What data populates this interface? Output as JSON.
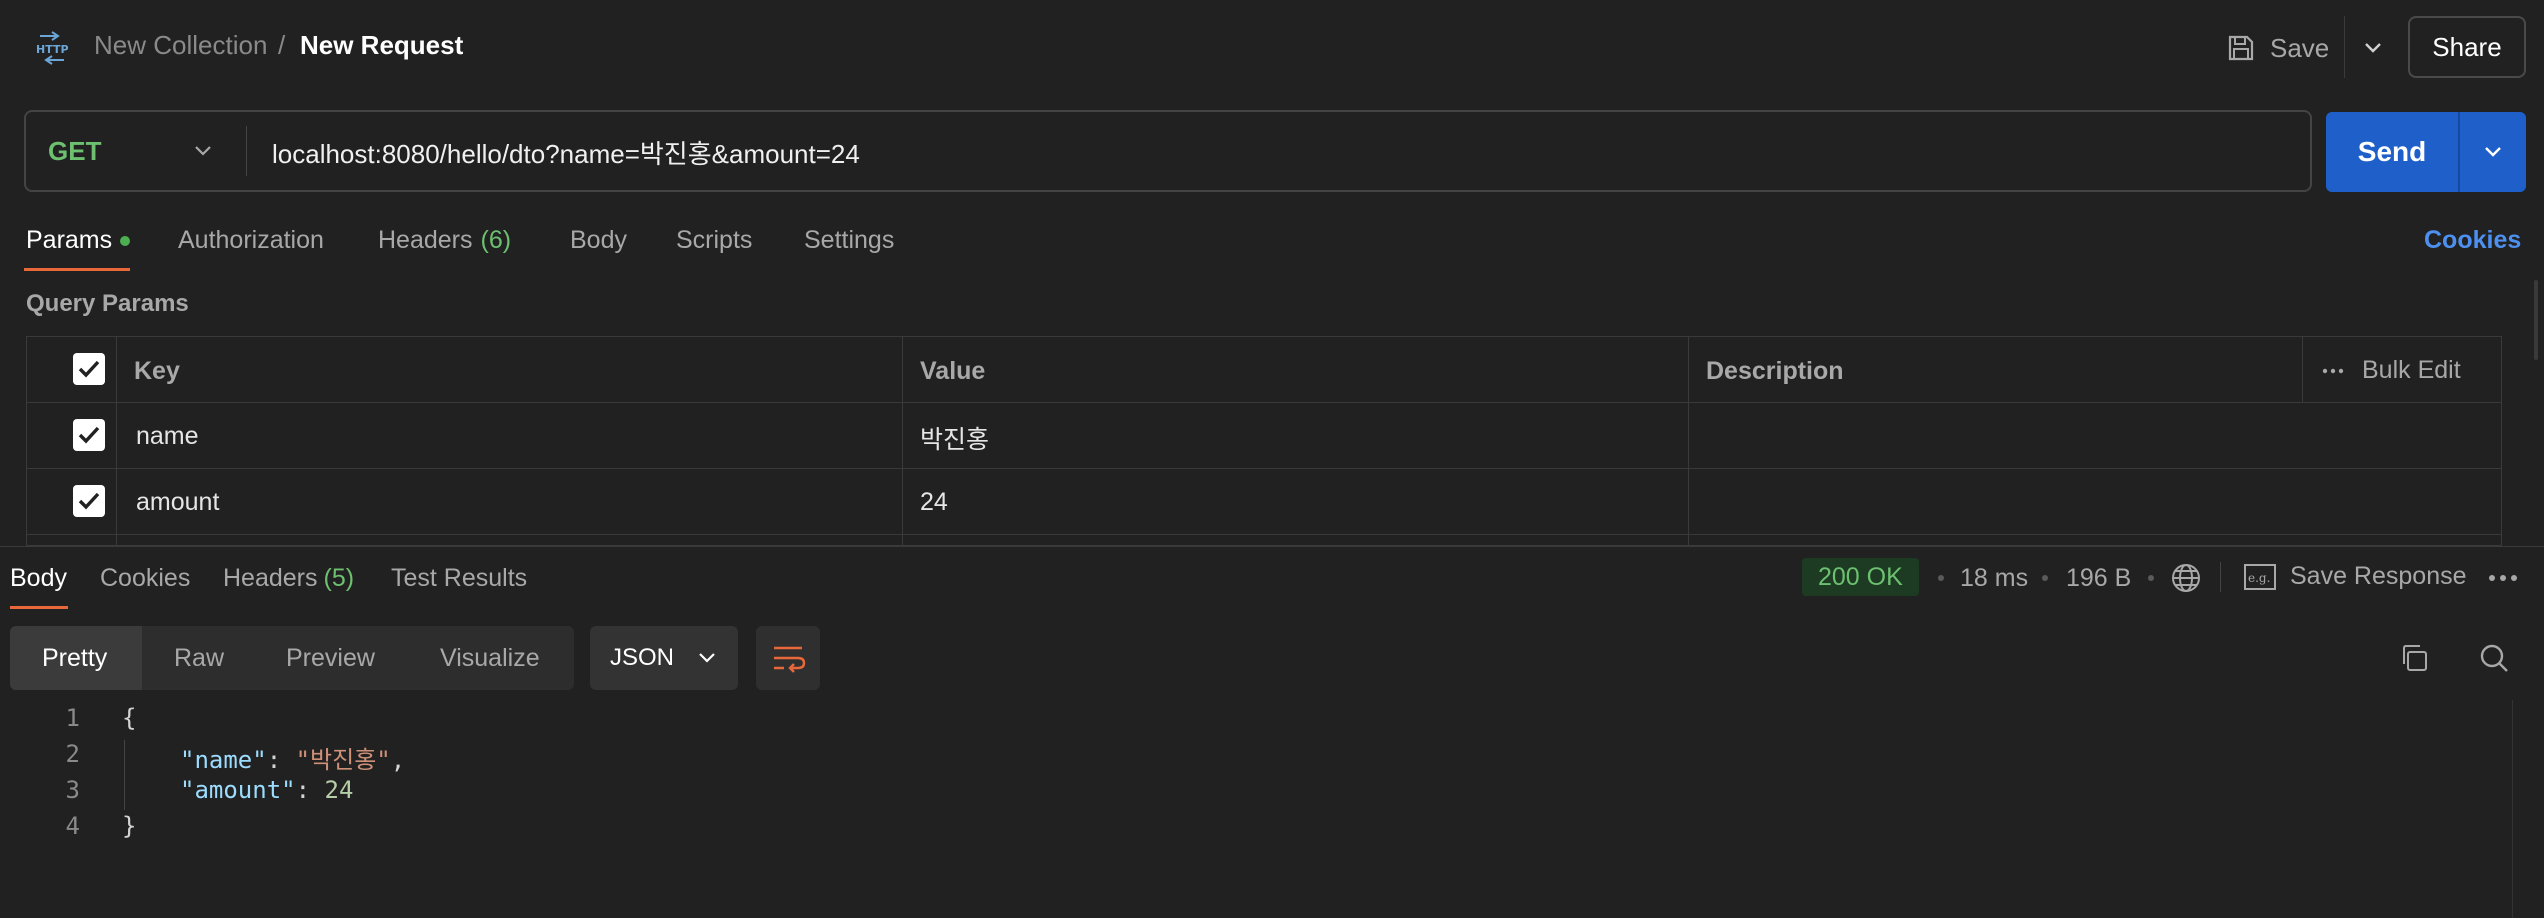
{
  "header": {
    "breadcrumb_collection": "New Collection",
    "breadcrumb_separator": "/",
    "breadcrumb_request": "New Request",
    "save_label": "Save",
    "share_label": "Share"
  },
  "request": {
    "method": "GET",
    "url": "localhost:8080/hello/dto?name=박진홍&amount=24",
    "send_label": "Send"
  },
  "request_tabs": {
    "params": "Params",
    "authorization": "Authorization",
    "headers": "Headers",
    "headers_count": "(6)",
    "body": "Body",
    "scripts": "Scripts",
    "settings": "Settings",
    "cookies": "Cookies"
  },
  "query_params": {
    "title": "Query Params",
    "columns": {
      "key": "Key",
      "value": "Value",
      "description": "Description"
    },
    "bulk_edit": "Bulk Edit",
    "rows": [
      {
        "key": "name",
        "value": "박진홍",
        "description": ""
      },
      {
        "key": "amount",
        "value": "24",
        "description": ""
      }
    ]
  },
  "response_tabs": {
    "body": "Body",
    "cookies": "Cookies",
    "headers": "Headers",
    "headers_count": "(5)",
    "test_results": "Test Results"
  },
  "response_meta": {
    "status": "200 OK",
    "time": "18 ms",
    "size": "196 B",
    "save_response": "Save Response"
  },
  "view_modes": [
    "Pretty",
    "Raw",
    "Preview",
    "Visualize"
  ],
  "format": "JSON",
  "code": {
    "line_numbers": [
      "1",
      "2",
      "3",
      "4"
    ],
    "open_brace": "{",
    "close_brace": "}",
    "name_key": "\"name\"",
    "name_value": "\"박진홍\"",
    "amount_key": "\"amount\"",
    "amount_value": "24"
  },
  "colors": {
    "accent_orange": "#e8683a",
    "send_blue": "#1f5fc9",
    "method_green": "#6cc070",
    "link_blue": "#4d90f0"
  }
}
